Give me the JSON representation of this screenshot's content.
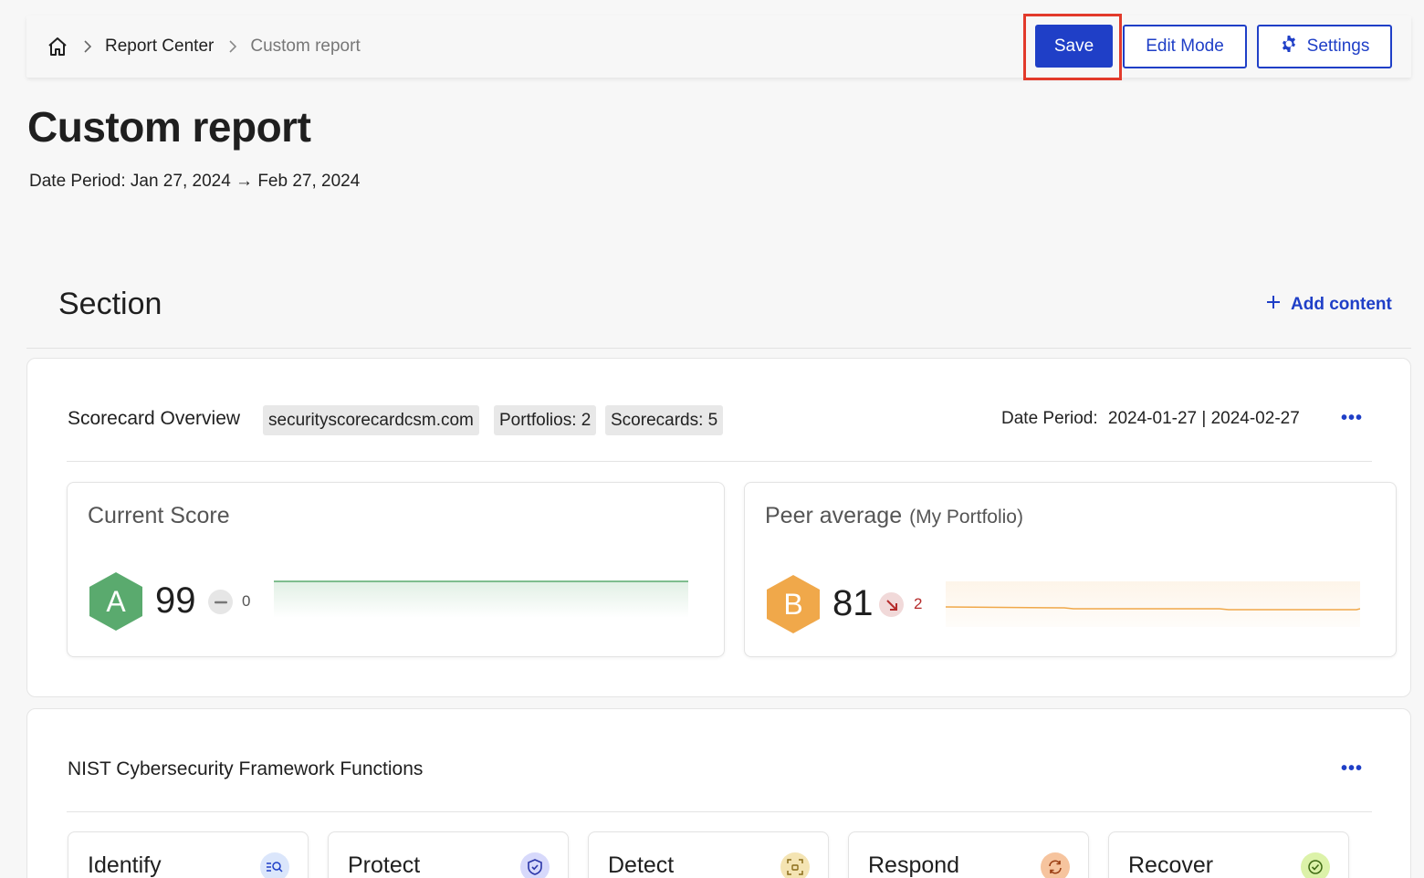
{
  "breadcrumb": {
    "home_icon": "home-icon",
    "items": [
      "Report Center",
      "Custom report"
    ]
  },
  "toolbar": {
    "save_label": "Save",
    "edit_label": "Edit Mode",
    "settings_label": "Settings",
    "accent_color": "#1f3fc7",
    "highlight_color": "#e23a2b"
  },
  "page": {
    "title": "Custom report",
    "date_period": "Date Period: Jan 27, 2024 → Feb 27, 2024"
  },
  "section": {
    "title": "Section",
    "add_content_label": "Add content"
  },
  "overview": {
    "title": "Scorecard Overview",
    "chips": [
      "securityscorecardcsm.com",
      "Portfolios: 2",
      "Scorecards: 5"
    ],
    "date_label": "Date Period:",
    "date_value": "2024-01-27 | 2024-02-27",
    "current": {
      "title": "Current Score",
      "grade": "A",
      "grade_color": "#5aaa6e",
      "score": "99",
      "delta": "0",
      "delta_direction": "flat"
    },
    "peer": {
      "title": "Peer average",
      "subtitle": "(My Portfolio)",
      "grade": "B",
      "grade_color": "#f0a84a",
      "score": "81",
      "delta": "2",
      "delta_direction": "down"
    }
  },
  "nist": {
    "title": "NIST Cybersecurity Framework Functions",
    "functions": [
      {
        "label": "Identify",
        "icon": "identify-search-icon",
        "color": "#dbe6fb"
      },
      {
        "label": "Protect",
        "icon": "shield-icon",
        "color": "#d7d9fb"
      },
      {
        "label": "Detect",
        "icon": "detect-scan-icon",
        "color": "#f4e4b3"
      },
      {
        "label": "Respond",
        "icon": "refresh-icon",
        "color": "#f6c49e"
      },
      {
        "label": "Recover",
        "icon": "check-circle-icon",
        "color": "#dcf2a9"
      }
    ]
  }
}
